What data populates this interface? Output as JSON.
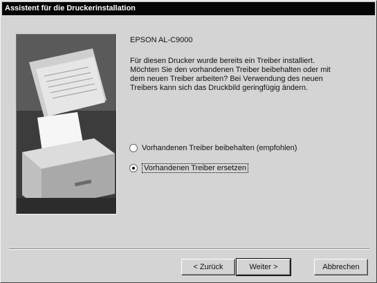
{
  "window": {
    "title": "Assistent für die Druckerinstallation"
  },
  "model_name": "EPSON AL-C9000",
  "message": "Für diesen Drucker wurde bereits ein Treiber installiert. Möchten Sie den vorhandenen Treiber beibehalten oder mit dem neuen Treiber arbeiten? Bei Verwendung des neuen Treibers kann sich das Druckbild geringfügig ändern.",
  "options": [
    {
      "label": "Vorhandenen Treiber beibehalten (empfohlen)",
      "selected": false
    },
    {
      "label": "Vorhandenen Treiber ersetzen",
      "selected": true
    }
  ],
  "buttons": {
    "back": "< Zurück",
    "next": "Weiter >",
    "cancel": "Abbrechen"
  },
  "colors": {
    "dialog_background": "#d4d4d4",
    "title_bar": "#050505"
  }
}
